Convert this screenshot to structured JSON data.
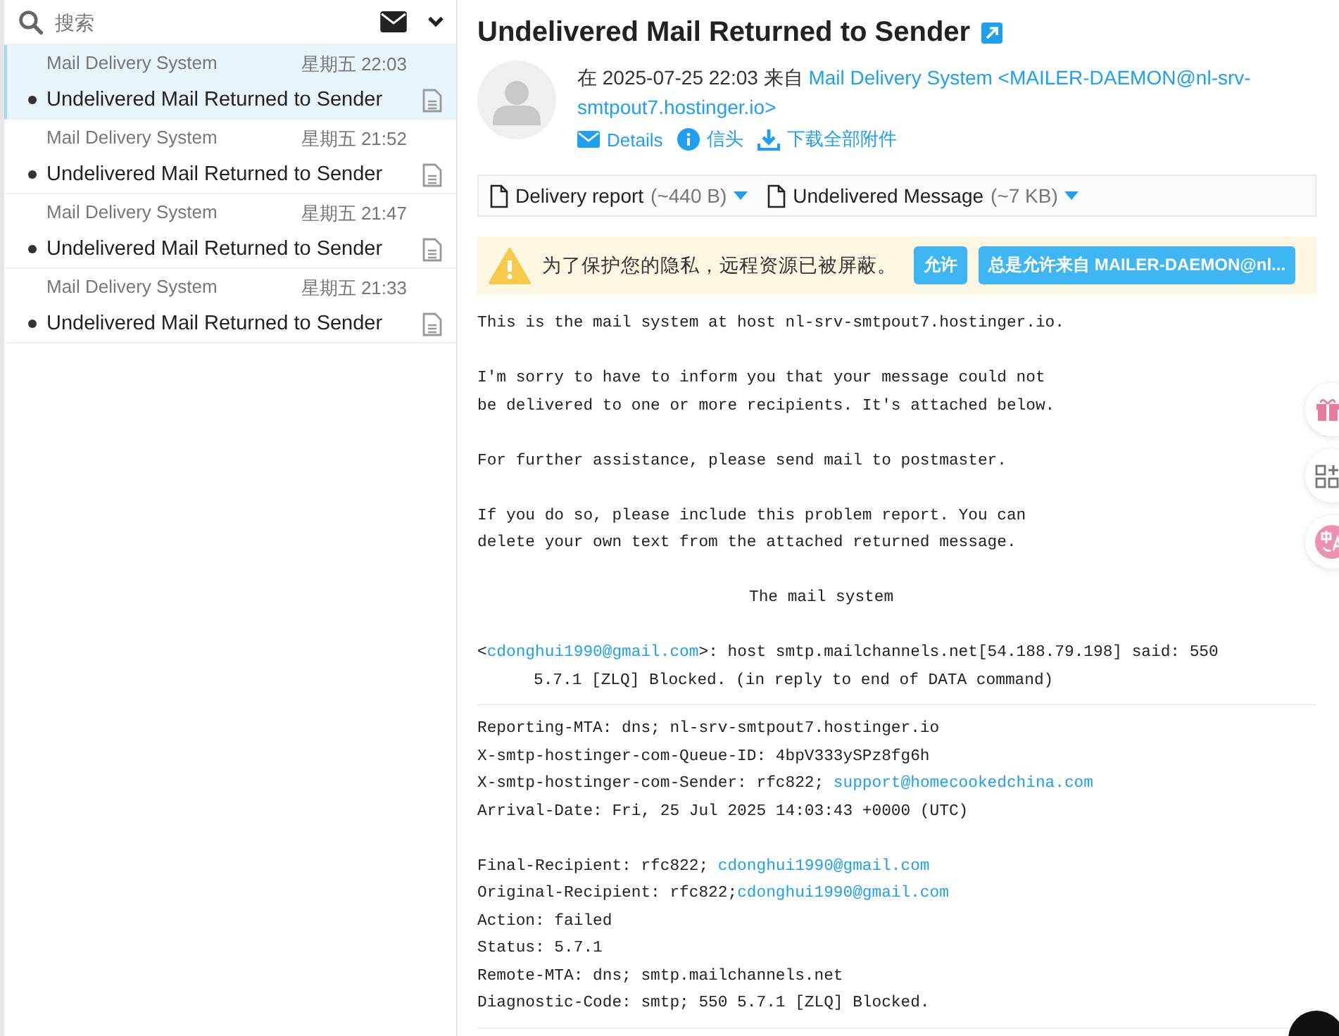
{
  "search": {
    "placeholder": "搜索"
  },
  "messages": [
    {
      "sender": "Mail Delivery System",
      "time": "星期五 22:03",
      "subject": "Undelivered Mail Returned to Sender",
      "selected": true
    },
    {
      "sender": "Mail Delivery System",
      "time": "星期五 21:52",
      "subject": "Undelivered Mail Returned to Sender",
      "selected": false
    },
    {
      "sender": "Mail Delivery System",
      "time": "星期五 21:47",
      "subject": "Undelivered Mail Returned to Sender",
      "selected": false
    },
    {
      "sender": "Mail Delivery System",
      "time": "星期五 21:33",
      "subject": "Undelivered Mail Returned to Sender",
      "selected": false
    }
  ],
  "mail": {
    "subject": "Undelivered Mail Returned to Sender",
    "meta_prefix": "在 2025-07-25 22:03 来自",
    "from": [
      "Mail Delivery System <MAILER-DAEMON@nl-srv-",
      "smtpout7.hostinger.io>"
    ],
    "actions": [
      {
        "kind": "envelope",
        "label": "Details"
      },
      {
        "kind": "info",
        "label": "信头"
      },
      {
        "kind": "download",
        "label": "下载全部附件"
      }
    ],
    "attachments": [
      {
        "name": "Delivery report",
        "size": "(~440 B)"
      },
      {
        "name": "Undelivered Message",
        "size": "(~7 KB)"
      }
    ],
    "notice": {
      "text": "为了保护您的隐私，远程资源已被屏蔽。",
      "buttons": [
        "允许",
        "总是允许来自 MAILER-DAEMON@nl..."
      ]
    },
    "body": [
      [
        {
          "segments": [
            {
              "kind": "text",
              "text": "This is the mail system at host nl-srv-smtpout7.hostinger.io."
            }
          ]
        }
      ],
      [
        {
          "segments": [
            {
              "kind": "text",
              "text": "I'm sorry to have to inform you that your message could not"
            }
          ]
        },
        {
          "segments": [
            {
              "kind": "text",
              "text": "be delivered to one or more recipients. It's attached below."
            }
          ]
        }
      ],
      [
        {
          "segments": [
            {
              "kind": "text",
              "text": "For further assistance, please send mail to postmaster."
            }
          ]
        }
      ],
      [
        {
          "segments": [
            {
              "kind": "text",
              "text": "If you do so, please include this problem report. You can"
            }
          ]
        },
        {
          "segments": [
            {
              "kind": "text",
              "text": "delete your own text from the attached returned message."
            }
          ]
        }
      ],
      [
        {
          "kind": "centered",
          "segments": [
            {
              "kind": "text",
              "text": "The mail system"
            }
          ]
        }
      ],
      [
        {
          "segments": [
            {
              "kind": "text",
              "text": "<"
            },
            {
              "kind": "link",
              "text": "cdonghui1990@gmail.com"
            },
            {
              "kind": "text",
              "text": ">: host smtp.mailchannels.net[54.188.79.198] said: 550"
            }
          ]
        },
        {
          "kind": "indented",
          "segments": [
            {
              "kind": "text",
              "text": "5.7.1 [ZLQ] Blocked. (in reply to end of DATA command)"
            }
          ]
        }
      ]
    ],
    "report": [
      [
        {
          "segments": [
            {
              "kind": "text",
              "text": "Reporting-MTA: dns; nl-srv-smtpout7.hostinger.io"
            }
          ]
        },
        {
          "segments": [
            {
              "kind": "text",
              "text": "X-smtp-hostinger-com-Queue-ID: 4bpV333ySPz8fg6h"
            }
          ]
        },
        {
          "segments": [
            {
              "kind": "text",
              "text": "X-smtp-hostinger-com-Sender: rfc822; "
            },
            {
              "kind": "link",
              "text": "support@homecookedchina.com"
            }
          ]
        },
        {
          "segments": [
            {
              "kind": "text",
              "text": "Arrival-Date: Fri, 25 Jul 2025 14:03:43 +0000 (UTC)"
            }
          ]
        }
      ],
      [
        {
          "segments": [
            {
              "kind": "text",
              "text": "Final-Recipient: rfc822; "
            },
            {
              "kind": "link",
              "text": "cdonghui1990@gmail.com"
            }
          ]
        },
        {
          "segments": [
            {
              "kind": "text",
              "text": "Original-Recipient: rfc822;"
            },
            {
              "kind": "link",
              "text": "cdonghui1990@gmail.com"
            }
          ]
        },
        {
          "segments": [
            {
              "kind": "text",
              "text": "Action: failed"
            }
          ]
        },
        {
          "segments": [
            {
              "kind": "text",
              "text": "Status: 5.7.1"
            }
          ]
        },
        {
          "segments": [
            {
              "kind": "text",
              "text": "Remote-MTA: dns; smtp.mailchannels.net"
            }
          ]
        },
        {
          "segments": [
            {
              "kind": "text",
              "text": "Diagnostic-Code: smtp; 550 5.7.1 [ZLQ] Blocked."
            }
          ]
        }
      ]
    ]
  }
}
